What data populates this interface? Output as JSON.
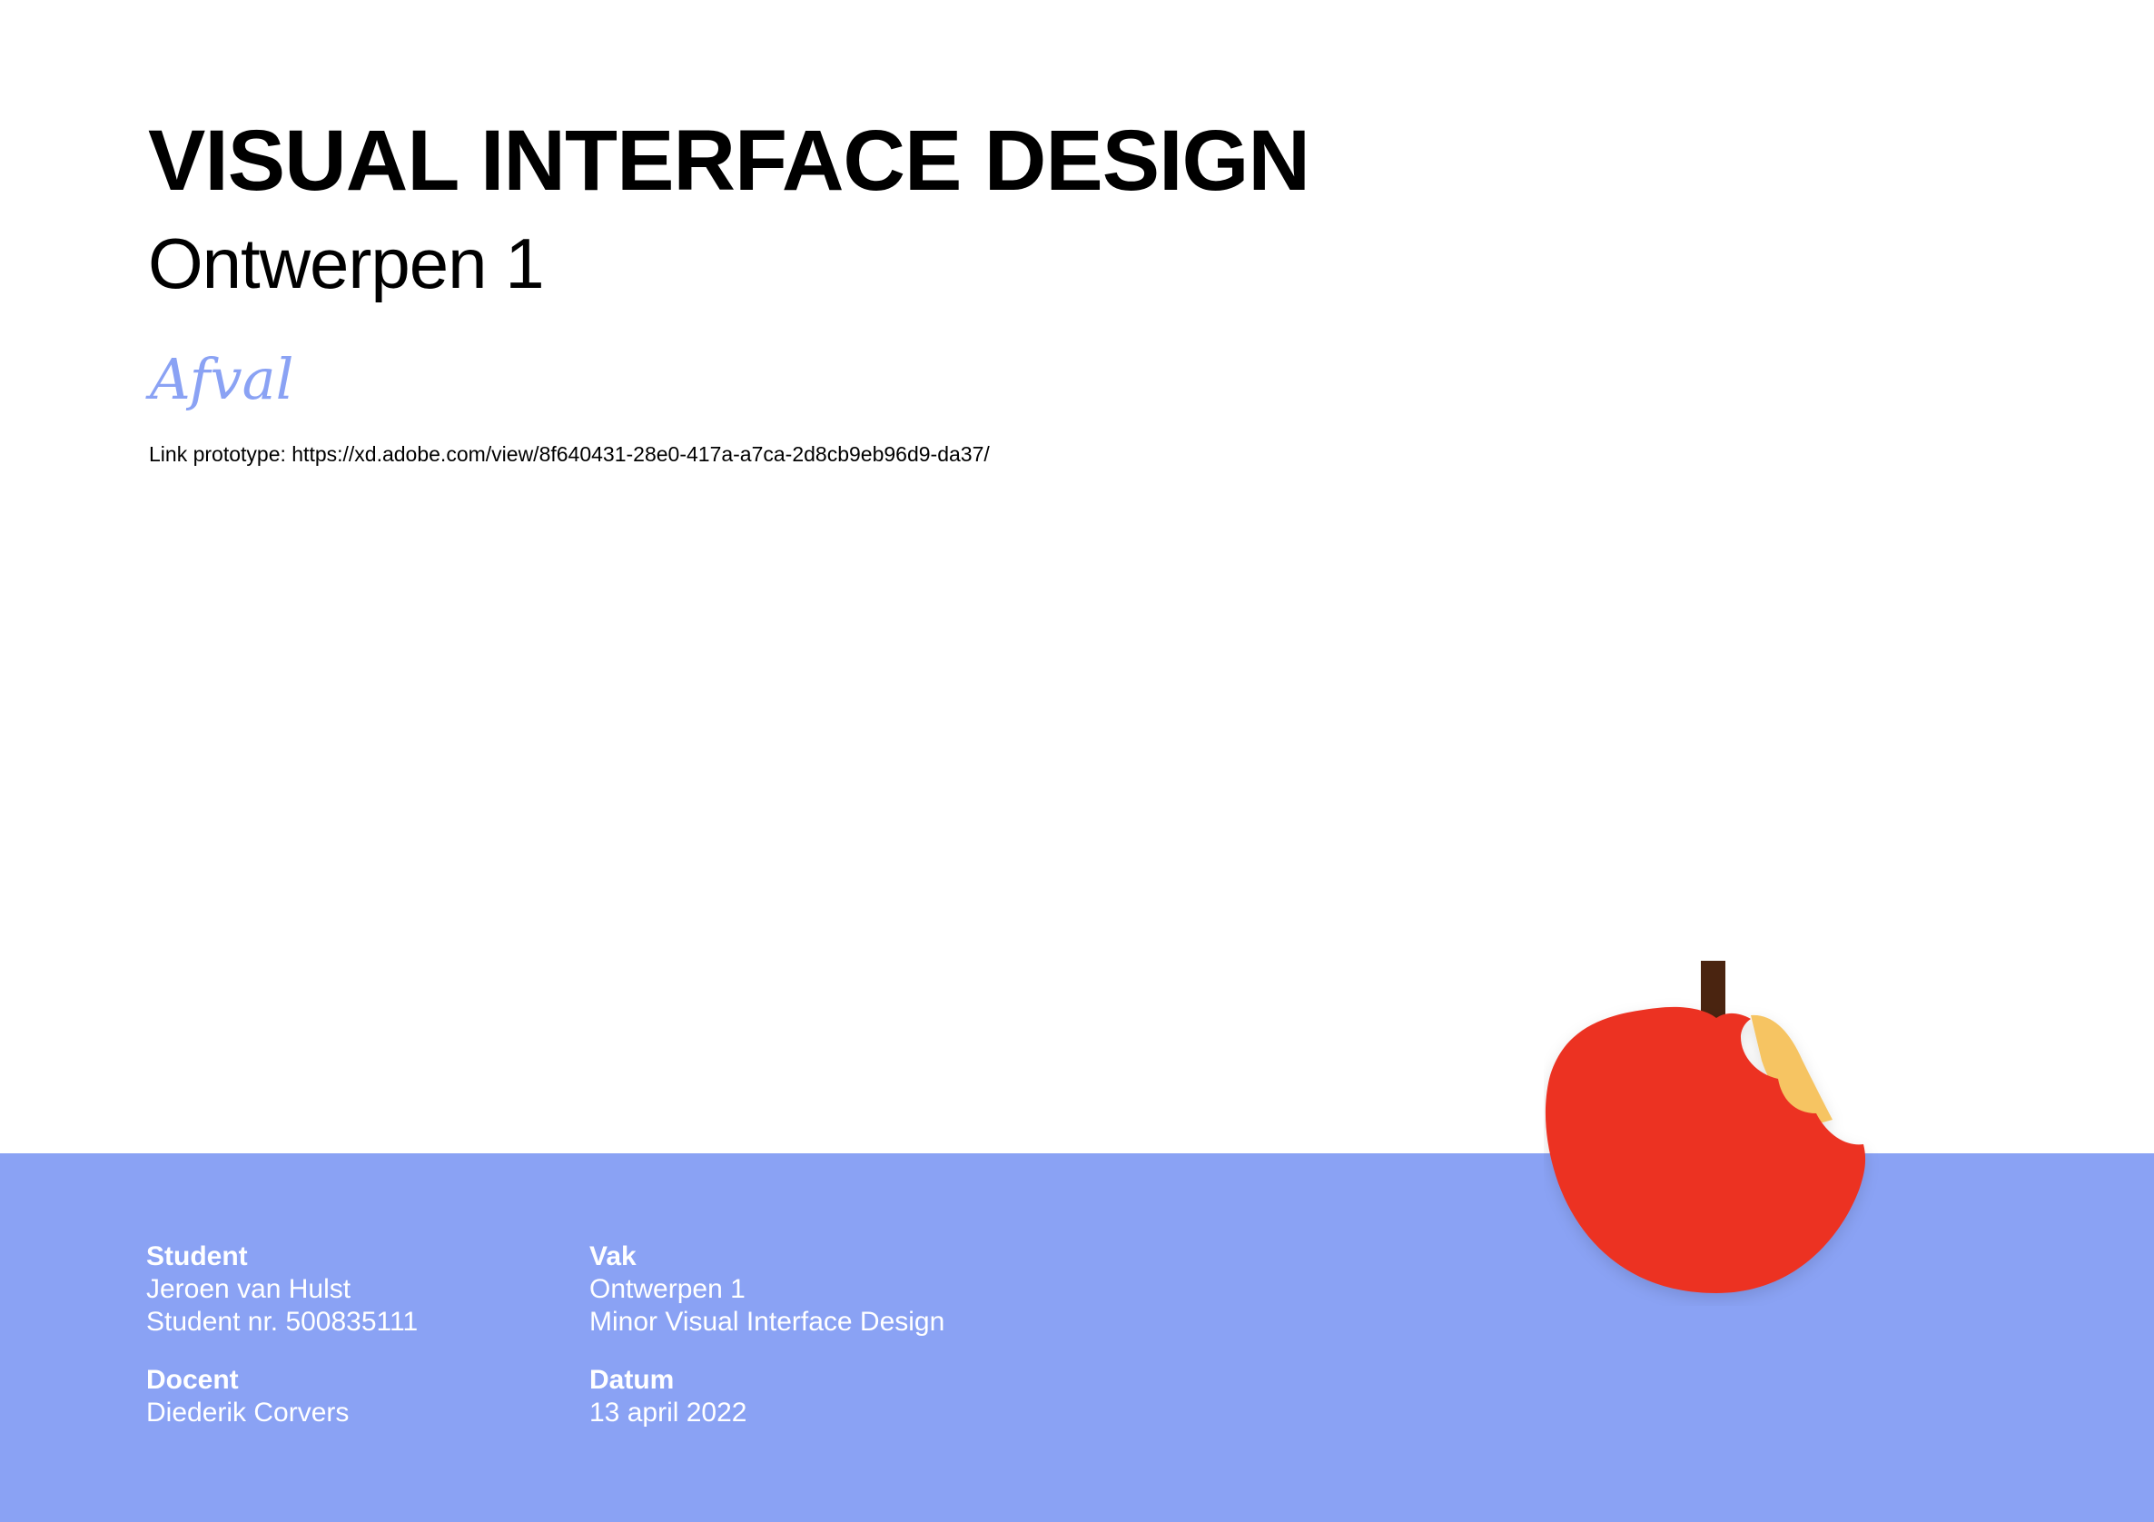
{
  "document": {
    "title": "VISUAL INTERFACE DESIGN",
    "subtitle": "Ontwerpen 1",
    "topic": "Afval",
    "link_line": "Link prototype: https://xd.adobe.com/view/8f640431-28e0-417a-a7ca-2d8cb9eb96d9-da37/"
  },
  "footer": {
    "student": {
      "label": "Student",
      "name": "Jeroen van Hulst",
      "number": "Student nr. 500835111"
    },
    "docent": {
      "label": "Docent",
      "name": "Diederik Corvers"
    },
    "vak": {
      "label": "Vak",
      "course": "Ontwerpen 1",
      "minor": "Minor Visual Interface Design"
    },
    "datum": {
      "label": "Datum",
      "date": "13 april 2022"
    }
  },
  "illustration": {
    "icon": "bitten-apple-icon"
  },
  "colors": {
    "accent_blue": "#8aa2f4",
    "apple_red": "#ec3324",
    "apple_flesh": "#f6c462",
    "stem": "#4a2410",
    "text": "#000000",
    "footer_text": "#ffffff"
  }
}
